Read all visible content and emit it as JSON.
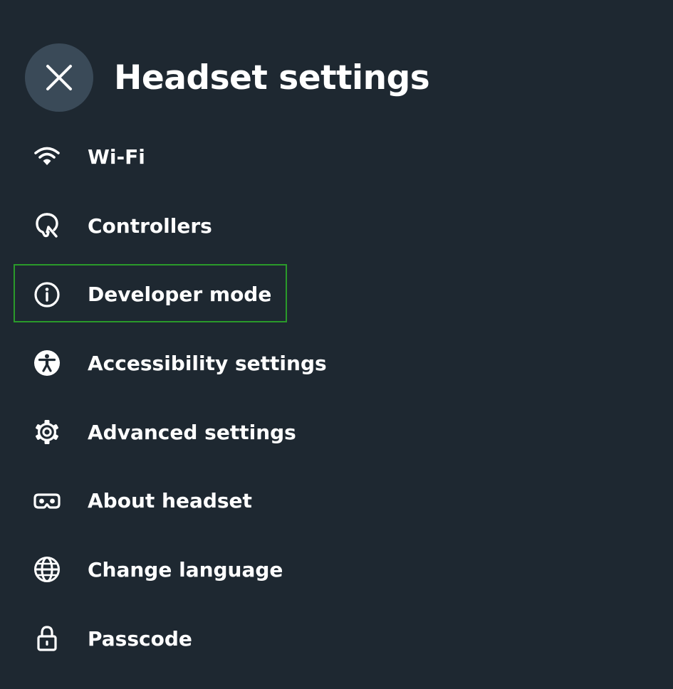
{
  "header": {
    "title": "Headset settings",
    "close_icon": "close-icon"
  },
  "menu": {
    "items": [
      {
        "label": "Wi-Fi",
        "icon": "wifi-icon"
      },
      {
        "label": "Controllers",
        "icon": "controller-icon"
      },
      {
        "label": "Developer mode",
        "icon": "info-icon",
        "highlighted": true
      },
      {
        "label": "Accessibility settings",
        "icon": "accessibility-icon"
      },
      {
        "label": "Advanced settings",
        "icon": "gear-icon"
      },
      {
        "label": "About headset",
        "icon": "headset-icon"
      },
      {
        "label": "Change language",
        "icon": "globe-icon"
      },
      {
        "label": "Passcode",
        "icon": "lock-icon"
      }
    ]
  },
  "colors": {
    "background": "#1e2831",
    "close_button": "#3a4a58",
    "text": "#ffffff",
    "highlight": "#2a9a2a"
  }
}
